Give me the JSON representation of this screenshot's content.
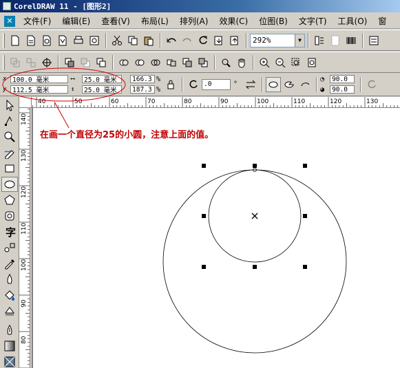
{
  "window": {
    "title": "CorelDRAW 11 - [图形2]"
  },
  "menu": [
    "文件(F)",
    "编辑(E)",
    "查看(V)",
    "布局(L)",
    "排列(A)",
    "效果(C)",
    "位图(B)",
    "文字(T)",
    "工具(O)",
    "窗"
  ],
  "toolbar": {
    "zoom_value": "292%"
  },
  "properties": {
    "x": "100.0 毫米",
    "y": "112.5 毫米",
    "width": "25.0 毫米",
    "height": "25.0 毫米",
    "scale_x": "166.3",
    "scale_y": "187.3",
    "percent": "%",
    "rotation": ".0",
    "degree": "°",
    "start_angle": "90.0",
    "end_angle": "90.0"
  },
  "ruler_h_labels": [
    "40",
    "50",
    "60",
    "70",
    "80",
    "90",
    "100",
    "110",
    "120",
    "130"
  ],
  "ruler_v_labels": [
    "140",
    "130",
    "120",
    "110",
    "100",
    "90",
    "80"
  ],
  "annotation": {
    "text": "在画一个直径为25的小圆，注意上面的值。"
  },
  "colors": {
    "annotation": "#c00000",
    "title_bar": "#0a246a"
  }
}
